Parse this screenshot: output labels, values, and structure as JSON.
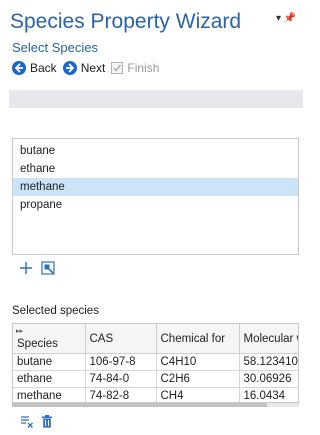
{
  "wizard": {
    "title": "Species Property Wizard",
    "subtitle": "Select Species",
    "back_label": "Back",
    "next_label": "Next",
    "finish_label": "Finish"
  },
  "species_list": {
    "items": [
      "butane",
      "ethane",
      "methane",
      "propane"
    ],
    "selected": "methane"
  },
  "selected_species": {
    "label": "Selected species",
    "columns": [
      "Species",
      "CAS",
      "Chemical for",
      "Molecular we"
    ],
    "rows": [
      [
        "butane",
        "106-97-8",
        "C4H10",
        "58.123410"
      ],
      [
        "ethane",
        "74-84-0",
        "C2H6",
        "30.06926"
      ],
      [
        "methane",
        "74-82-8",
        "CH4",
        "16.0434"
      ]
    ]
  },
  "colors": {
    "accent": "#2c63a8",
    "nav_button": "#1a66c9",
    "selection": "#cce4f7"
  }
}
